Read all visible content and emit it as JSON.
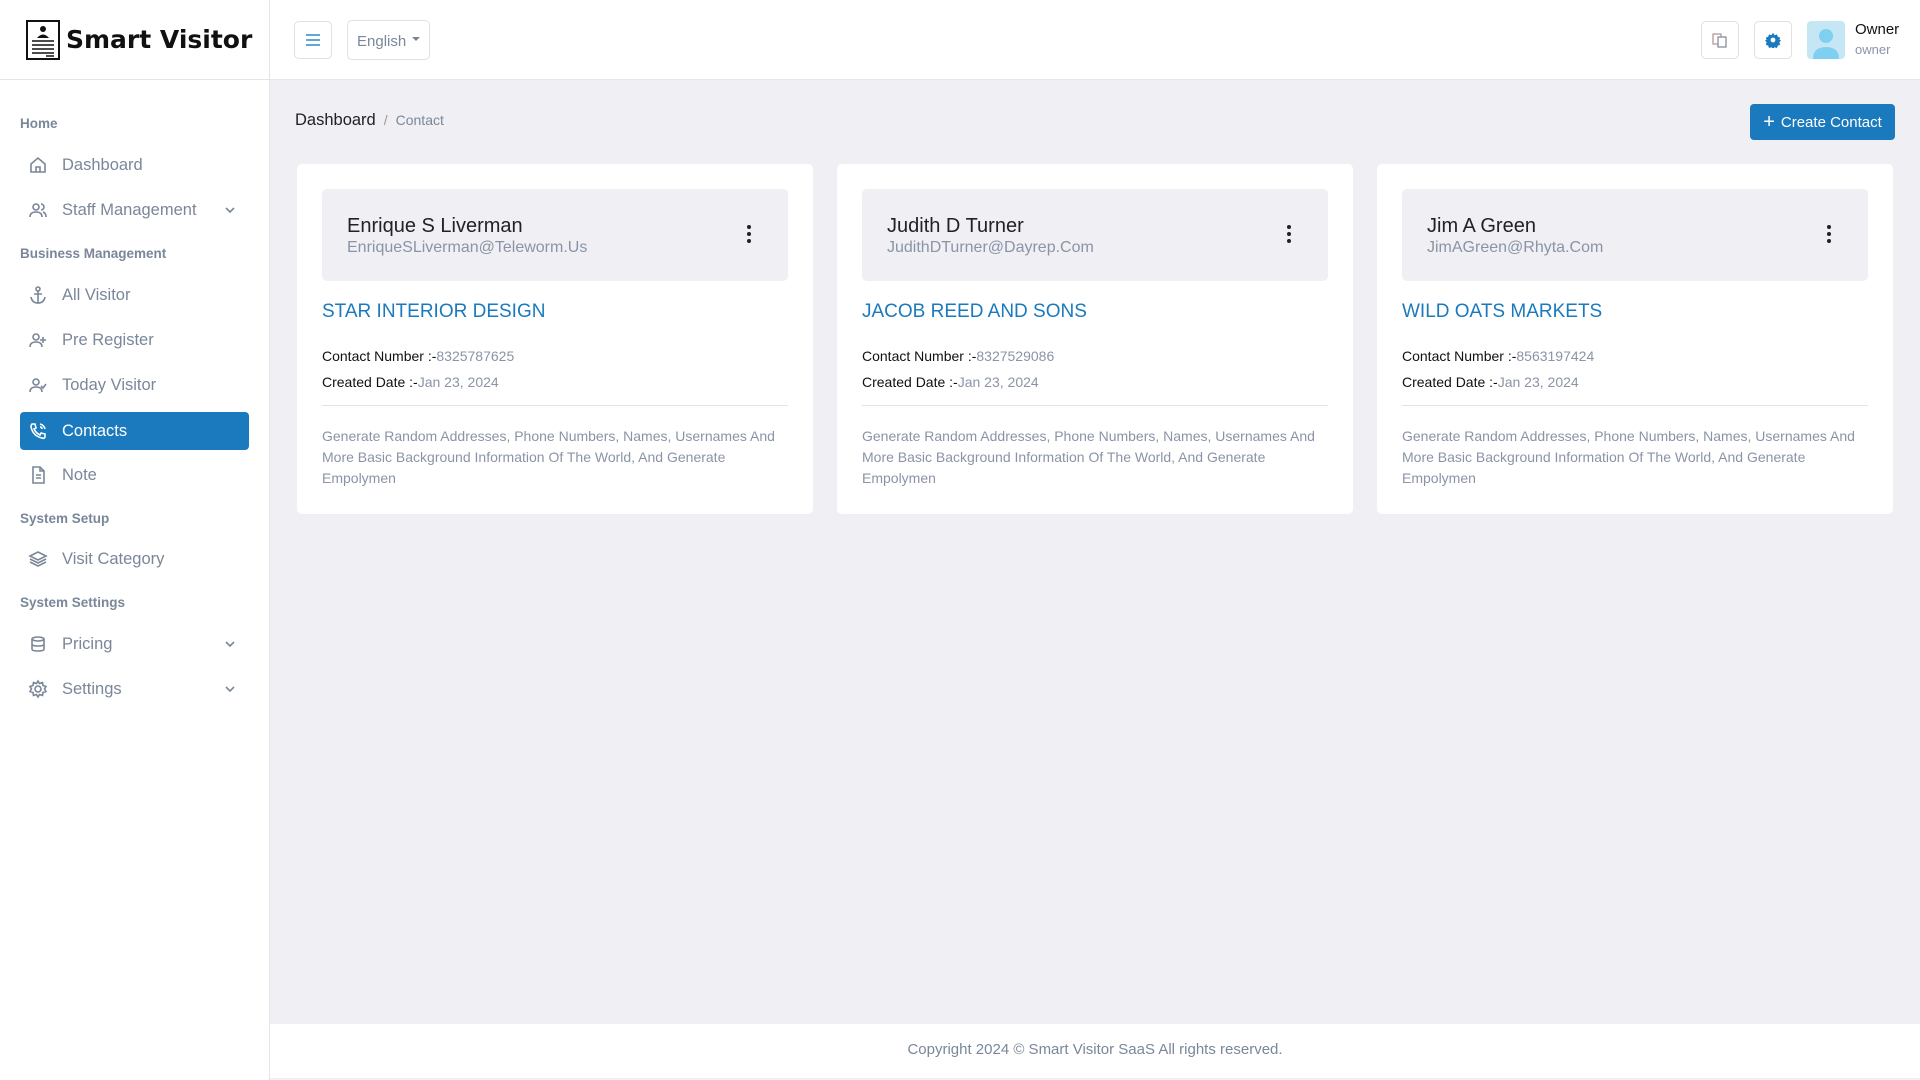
{
  "brand": {
    "name": "Smart Visitor"
  },
  "header": {
    "language": "English",
    "user_name": "Owner",
    "user_role": "owner"
  },
  "sidebar": {
    "sections": [
      "Home",
      "Business Management",
      "System Setup",
      "System Settings"
    ],
    "items": [
      {
        "label": "Dashboard"
      },
      {
        "label": "Staff Management"
      },
      {
        "label": "All Visitor"
      },
      {
        "label": "Pre Register"
      },
      {
        "label": "Today Visitor"
      },
      {
        "label": "Contacts"
      },
      {
        "label": "Note"
      },
      {
        "label": "Visit Category"
      },
      {
        "label": "Pricing"
      },
      {
        "label": "Settings"
      }
    ]
  },
  "breadcrumb": {
    "root": "Dashboard",
    "sep": "/",
    "current": "Contact"
  },
  "create_label": "Create Contact",
  "labels": {
    "contact": "Contact Number :-",
    "created": "Created Date :-"
  },
  "contacts": [
    {
      "name": "Enrique S Liverman",
      "email": "EnriqueSLiverman@Teleworm.Us",
      "company": "STAR INTERIOR DESIGN",
      "phone": "8325787625",
      "date": "Jan 23, 2024",
      "desc": "Generate Random Addresses, Phone Numbers, Names, Usernames And More Basic Background Information Of The World, And Generate Empolymen"
    },
    {
      "name": "Judith D Turner",
      "email": "JudithDTurner@Dayrep.Com",
      "company": "JACOB REED AND SONS",
      "phone": "8327529086",
      "date": "Jan 23, 2024",
      "desc": "Generate Random Addresses, Phone Numbers, Names, Usernames And More Basic Background Information Of The World, And Generate Empolymen"
    },
    {
      "name": "Jim A Green",
      "email": "JimAGreen@Rhyta.Com",
      "company": "WILD OATS MARKETS",
      "phone": "8563197424",
      "date": "Jan 23, 2024",
      "desc": "Generate Random Addresses, Phone Numbers, Names, Usernames And More Basic Background Information Of The World, And Generate Empolymen"
    }
  ],
  "footer": "Copyright 2024 © Smart Visitor SaaS All rights reserved."
}
